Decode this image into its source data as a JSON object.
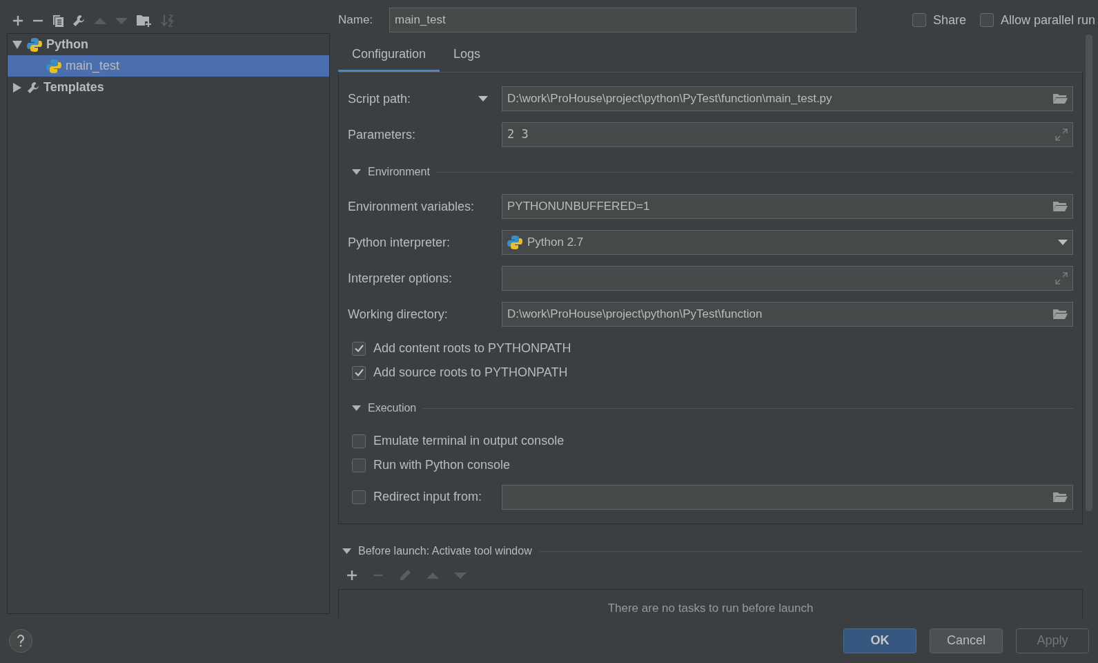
{
  "toolbar": [
    {
      "kind": "add",
      "disabled": false
    },
    {
      "kind": "remove",
      "disabled": false
    },
    {
      "kind": "copy",
      "disabled": false
    },
    {
      "kind": "wrench",
      "disabled": false
    },
    {
      "kind": "up",
      "disabled": true
    },
    {
      "kind": "down",
      "disabled": true
    },
    {
      "kind": "folder",
      "disabled": false
    },
    {
      "kind": "sort",
      "disabled": true
    }
  ],
  "tree": [
    {
      "label": "Python",
      "kind": "type",
      "expanded": true,
      "selected": false,
      "children": [
        {
          "label": "main_test",
          "kind": "config",
          "selected": true
        }
      ]
    },
    {
      "label": "Templates",
      "kind": "templates",
      "expanded": false,
      "selected": false
    }
  ],
  "name": {
    "label": "Name:",
    "value": "main_test"
  },
  "options": [
    {
      "label": "Share",
      "checked": false
    },
    {
      "label": "Allow parallel run",
      "checked": false
    }
  ],
  "tabs": [
    {
      "label": "Configuration",
      "selected": true
    },
    {
      "label": "Logs",
      "selected": false
    }
  ],
  "sections": [
    {
      "kind": "fields",
      "rows": [
        {
          "label": "Script path:",
          "has_caret": true,
          "kind": "path",
          "value": "D:\\work\\ProHouse\\project\\python\\PyTest\\function\\main_test.py"
        },
        {
          "label": "Parameters:",
          "kind": "expand",
          "value": "2 3",
          "mono": true
        }
      ]
    },
    {
      "kind": "group",
      "title": "Environment",
      "expanded": true
    },
    {
      "kind": "fields",
      "rows": [
        {
          "label": "Environment variables:",
          "kind": "path",
          "value": "PYTHONUNBUFFERED=1"
        },
        {
          "label": "Python interpreter:",
          "kind": "dropdown",
          "value": "Python 2.7"
        },
        {
          "label": "Interpreter options:",
          "kind": "expand"
        },
        {
          "label": "Working directory:",
          "kind": "path",
          "value": "D:\\work\\ProHouse\\project\\python\\PyTest\\function"
        }
      ]
    },
    {
      "kind": "checks",
      "items": [
        {
          "label": "Add content roots to PYTHONPATH",
          "checked": true
        },
        {
          "label": "Add source roots to PYTHONPATH",
          "checked": true
        }
      ]
    },
    {
      "kind": "group",
      "title": "Execution",
      "expanded": true
    },
    {
      "kind": "checks",
      "items": [
        {
          "label": "Emulate terminal in output console",
          "checked": false
        },
        {
          "label": "Run with Python console",
          "checked": false
        }
      ]
    },
    {
      "kind": "checkfield",
      "label": "Redirect input from:",
      "checked": false
    }
  ],
  "before_launch": {
    "title": "Before launch: Activate tool window",
    "expanded": true,
    "tools": [
      {
        "kind": "add",
        "disabled": false
      },
      {
        "kind": "remove",
        "disabled": true
      },
      {
        "kind": "edit",
        "disabled": true
      },
      {
        "kind": "up",
        "disabled": true
      },
      {
        "kind": "down",
        "disabled": true
      }
    ],
    "empty_text": "There are no tasks to run before launch"
  },
  "buttons": [
    {
      "label": "OK",
      "kind": "default",
      "disabled": false
    },
    {
      "label": "Cancel",
      "kind": "normal",
      "disabled": false
    },
    {
      "label": "Apply",
      "kind": "normal",
      "disabled": true
    }
  ]
}
